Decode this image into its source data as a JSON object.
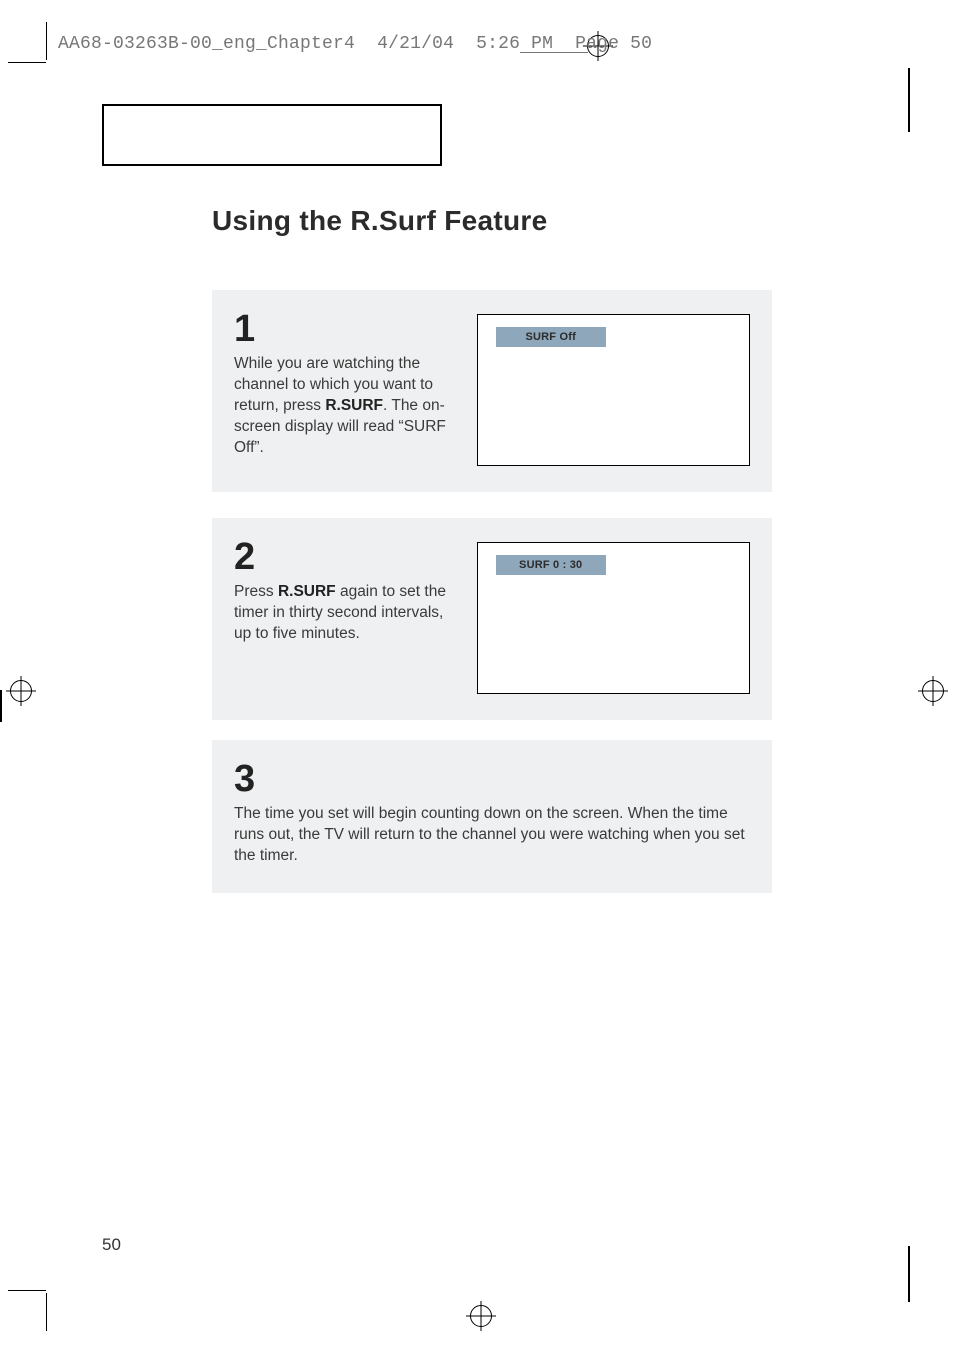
{
  "slug": {
    "filename": "AA68-03263B-00_eng_Chapter4",
    "date": "4/21/04",
    "time": "5:26 PM",
    "page_label": "Page 50"
  },
  "title": "Using the R.Surf Feature",
  "steps": {
    "s1": {
      "num": "1",
      "pre": "While you are watching the channel to which you want to return, press ",
      "bold": "R.SURF",
      "post": ". The on-screen display will read “SURF Off”.",
      "osd": "SURF Off"
    },
    "s2": {
      "num": "2",
      "pre": "Press ",
      "bold": "R.SURF",
      "post": " again to set the timer in thirty second intervals, up to five minutes.",
      "osd": "SURF 0 : 30"
    },
    "s3": {
      "num": "3",
      "text": "The time you set will begin counting down on the screen. When the time runs out, the TV will return to the channel you were watching when you set the timer."
    }
  },
  "page_number": "50"
}
